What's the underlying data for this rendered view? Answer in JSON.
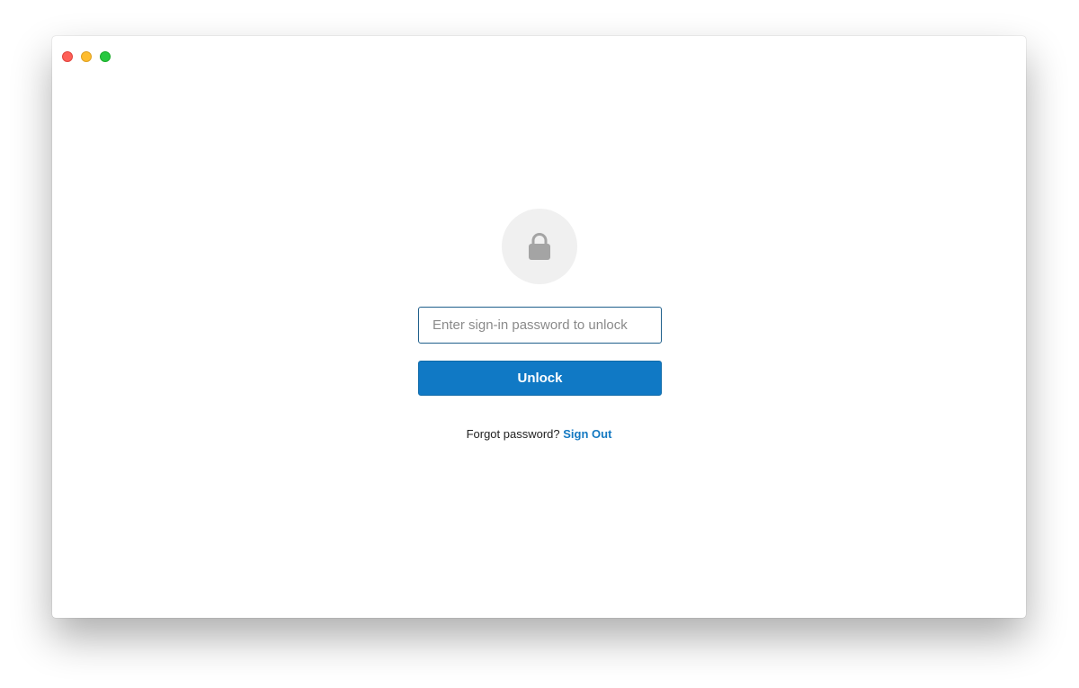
{
  "window": {
    "controls": [
      "close",
      "minimize",
      "zoom"
    ]
  },
  "lock": {
    "icon": "lock-icon"
  },
  "form": {
    "password_placeholder": "Enter sign-in password to unlock",
    "password_value": "",
    "unlock_label": "Unlock"
  },
  "footer": {
    "forgot_text": "Forgot password?",
    "signout_label": "Sign Out"
  },
  "colors": {
    "accent": "#1079c5",
    "link": "#1479c2",
    "field_border": "#1f5f8b",
    "lock_bg": "#f0f0f0",
    "lock_fg": "#a4a4a4"
  }
}
